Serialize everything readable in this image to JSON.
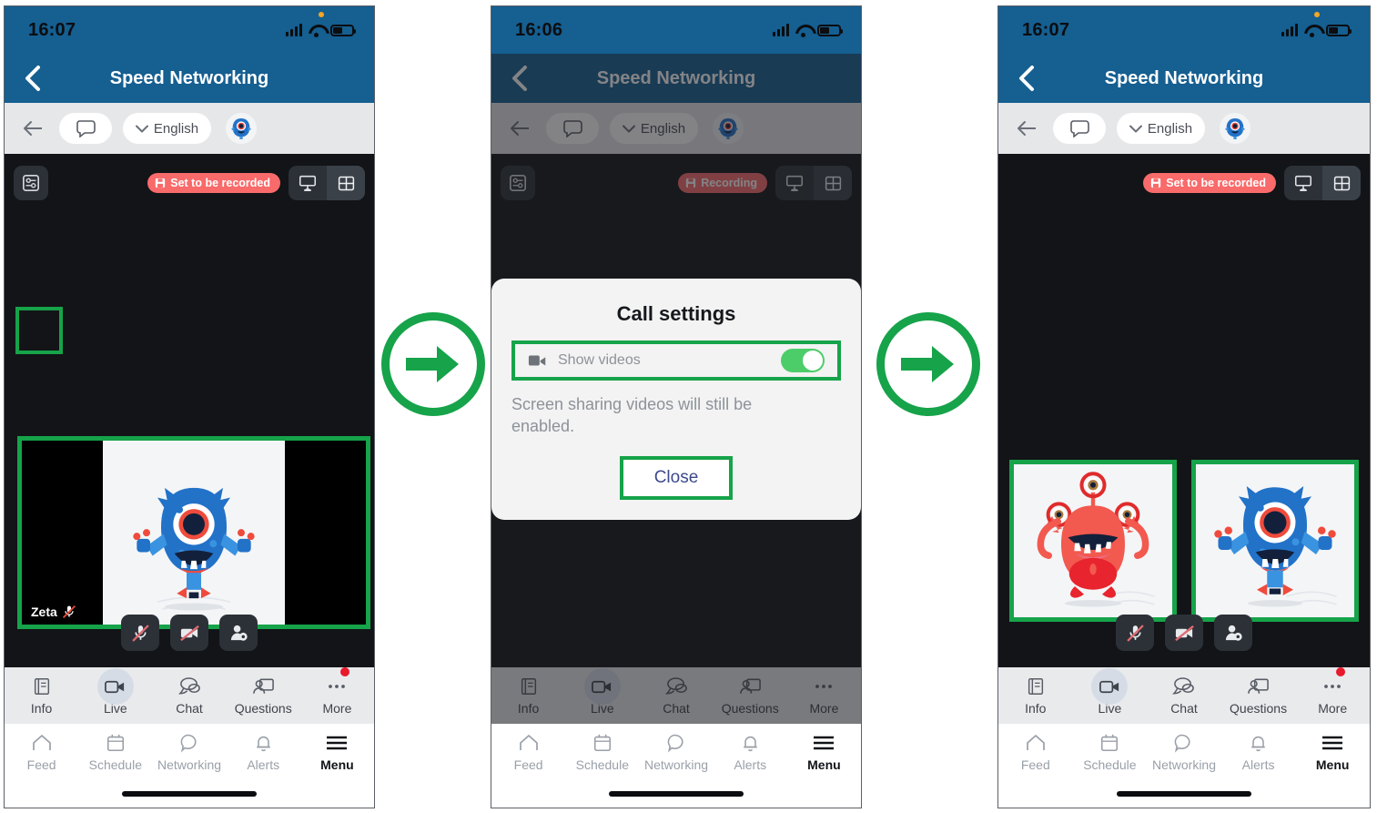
{
  "panels": [
    {
      "id": "panel-1",
      "status": {
        "time": "16:07"
      },
      "title": "Speed Networking",
      "toolbar": {
        "language": "English"
      },
      "video": {
        "recording_badge": "Set to be recorded",
        "participant_name": "Zeta"
      },
      "tabs_top": [
        "Info",
        "Live",
        "Chat",
        "Questions",
        "More"
      ],
      "tabs_bottom": [
        "Feed",
        "Schedule",
        "Networking",
        "Alerts",
        "Menu"
      ]
    },
    {
      "id": "panel-2",
      "status": {
        "time": "16:06"
      },
      "title": "Speed Networking",
      "toolbar": {
        "language": "English"
      },
      "video": {
        "recording_badge": "Recording"
      },
      "dialog": {
        "heading": "Call settings",
        "toggle_label": "Show videos",
        "toggle_state": "on",
        "description": "Screen sharing videos will still be enabled.",
        "close_label": "Close"
      },
      "tabs_top": [
        "Info",
        "Live",
        "Chat",
        "Questions",
        "More"
      ],
      "tabs_bottom": [
        "Feed",
        "Schedule",
        "Networking",
        "Alerts",
        "Menu"
      ]
    },
    {
      "id": "panel-3",
      "status": {
        "time": "16:07"
      },
      "title": "Speed Networking",
      "toolbar": {
        "language": "English"
      },
      "video": {
        "recording_badge": "Set to be recorded"
      },
      "tabs_top": [
        "Info",
        "Live",
        "Chat",
        "Questions",
        "More"
      ],
      "tabs_bottom": [
        "Feed",
        "Schedule",
        "Networking",
        "Alerts",
        "Menu"
      ]
    }
  ],
  "colors": {
    "header_blue": "#155f91",
    "highlight_green": "#16a34a",
    "toggle_green": "#4ccd6a",
    "recording_red": "#f96a6a",
    "badge_dot_red": "#e8192c",
    "link_blue": "#3d4a8c"
  }
}
